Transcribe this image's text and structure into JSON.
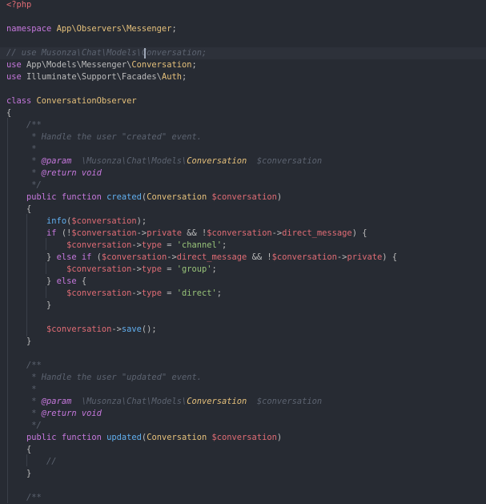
{
  "editor": {
    "language": "php",
    "theme": {
      "background": "#272b33",
      "default": "#bbbbbb",
      "keyword": "#c678dd",
      "class_name": "#e5c07b",
      "function": "#61afef",
      "variable": "#e06c75",
      "string": "#98c379",
      "comment": "#5c6370",
      "doc_tag": "#c678dd",
      "php_tag": "#e06c75"
    },
    "lines": [
      [
        {
          "t": "<?php",
          "c": "php_tag"
        }
      ],
      [],
      [
        {
          "t": "namespace ",
          "c": "keyword"
        },
        {
          "t": "App\\Observers\\Messenger",
          "c": "class_name"
        },
        {
          "t": ";",
          "c": "default"
        }
      ],
      [],
      [
        {
          "t": "// use Musonza\\Chat\\Models\\Conversation;",
          "c": "comment",
          "i": true
        }
      ],
      [
        {
          "t": "use ",
          "c": "keyword"
        },
        {
          "t": "App\\Models\\Messenger\\",
          "c": "default"
        },
        {
          "t": "Conversation",
          "c": "class_name"
        },
        {
          "t": ";",
          "c": "default"
        }
      ],
      [
        {
          "t": "use ",
          "c": "keyword"
        },
        {
          "t": "Illuminate\\Support\\Facades\\",
          "c": "default"
        },
        {
          "t": "Auth",
          "c": "class_name"
        },
        {
          "t": ";",
          "c": "default"
        }
      ],
      [],
      [
        {
          "t": "class ",
          "c": "keyword"
        },
        {
          "t": "ConversationObserver",
          "c": "class_name"
        }
      ],
      [
        {
          "t": "{",
          "c": "default"
        }
      ],
      [
        {
          "t": "    /**",
          "c": "comment",
          "i": true
        }
      ],
      [
        {
          "t": "     * Handle the user \"created\" event.",
          "c": "comment",
          "i": true
        }
      ],
      [
        {
          "t": "     *",
          "c": "comment",
          "i": true
        }
      ],
      [
        {
          "t": "     * ",
          "c": "comment",
          "i": true
        },
        {
          "t": "@param",
          "c": "doc_tag",
          "i": true
        },
        {
          "t": "  \\Musonza\\Chat\\Models\\",
          "c": "comment",
          "i": true
        },
        {
          "t": "Conversation",
          "c": "class_name",
          "i": true
        },
        {
          "t": "  $conversation",
          "c": "comment",
          "i": true
        }
      ],
      [
        {
          "t": "     * ",
          "c": "comment",
          "i": true
        },
        {
          "t": "@return",
          "c": "doc_tag",
          "i": true
        },
        {
          "t": " void",
          "c": "keyword",
          "i": true
        }
      ],
      [
        {
          "t": "     */",
          "c": "comment",
          "i": true
        }
      ],
      [
        {
          "t": "    public function ",
          "c": "keyword"
        },
        {
          "t": "created",
          "c": "function"
        },
        {
          "t": "(",
          "c": "default"
        },
        {
          "t": "Conversation ",
          "c": "class_name"
        },
        {
          "t": "$conversation",
          "c": "variable"
        },
        {
          "t": ")",
          "c": "default"
        }
      ],
      [
        {
          "t": "    {",
          "c": "default"
        }
      ],
      [
        {
          "t": "        ",
          "c": "default"
        },
        {
          "t": "info",
          "c": "function"
        },
        {
          "t": "(",
          "c": "default"
        },
        {
          "t": "$conversation",
          "c": "variable"
        },
        {
          "t": ");",
          "c": "default"
        }
      ],
      [
        {
          "t": "        ",
          "c": "default"
        },
        {
          "t": "if ",
          "c": "keyword"
        },
        {
          "t": "(!",
          "c": "default"
        },
        {
          "t": "$conversation",
          "c": "variable"
        },
        {
          "t": "->",
          "c": "default"
        },
        {
          "t": "private",
          "c": "variable"
        },
        {
          "t": " && !",
          "c": "default"
        },
        {
          "t": "$conversation",
          "c": "variable"
        },
        {
          "t": "->",
          "c": "default"
        },
        {
          "t": "direct_message",
          "c": "variable"
        },
        {
          "t": ") {",
          "c": "default"
        }
      ],
      [
        {
          "t": "            ",
          "c": "default"
        },
        {
          "t": "$conversation",
          "c": "variable"
        },
        {
          "t": "->",
          "c": "default"
        },
        {
          "t": "type",
          "c": "variable"
        },
        {
          "t": " = ",
          "c": "default"
        },
        {
          "t": "'channel'",
          "c": "string"
        },
        {
          "t": ";",
          "c": "default"
        }
      ],
      [
        {
          "t": "        } ",
          "c": "default"
        },
        {
          "t": "else if ",
          "c": "keyword"
        },
        {
          "t": "(",
          "c": "default"
        },
        {
          "t": "$conversation",
          "c": "variable"
        },
        {
          "t": "->",
          "c": "default"
        },
        {
          "t": "direct_message",
          "c": "variable"
        },
        {
          "t": " && !",
          "c": "default"
        },
        {
          "t": "$conversation",
          "c": "variable"
        },
        {
          "t": "->",
          "c": "default"
        },
        {
          "t": "private",
          "c": "variable"
        },
        {
          "t": ") {",
          "c": "default"
        }
      ],
      [
        {
          "t": "            ",
          "c": "default"
        },
        {
          "t": "$conversation",
          "c": "variable"
        },
        {
          "t": "->",
          "c": "default"
        },
        {
          "t": "type",
          "c": "variable"
        },
        {
          "t": " = ",
          "c": "default"
        },
        {
          "t": "'group'",
          "c": "string"
        },
        {
          "t": ";",
          "c": "default"
        }
      ],
      [
        {
          "t": "        } ",
          "c": "default"
        },
        {
          "t": "else ",
          "c": "keyword"
        },
        {
          "t": "{",
          "c": "default"
        }
      ],
      [
        {
          "t": "            ",
          "c": "default"
        },
        {
          "t": "$conversation",
          "c": "variable"
        },
        {
          "t": "->",
          "c": "default"
        },
        {
          "t": "type",
          "c": "variable"
        },
        {
          "t": " = ",
          "c": "default"
        },
        {
          "t": "'direct'",
          "c": "string"
        },
        {
          "t": ";",
          "c": "default"
        }
      ],
      [
        {
          "t": "        }",
          "c": "default"
        }
      ],
      [],
      [
        {
          "t": "        ",
          "c": "default"
        },
        {
          "t": "$conversation",
          "c": "variable"
        },
        {
          "t": "->",
          "c": "default"
        },
        {
          "t": "save",
          "c": "function"
        },
        {
          "t": "();",
          "c": "default"
        }
      ],
      [
        {
          "t": "    }",
          "c": "default"
        }
      ],
      [],
      [
        {
          "t": "    /**",
          "c": "comment",
          "i": true
        }
      ],
      [
        {
          "t": "     * Handle the user \"updated\" event.",
          "c": "comment",
          "i": true
        }
      ],
      [
        {
          "t": "     *",
          "c": "comment",
          "i": true
        }
      ],
      [
        {
          "t": "     * ",
          "c": "comment",
          "i": true
        },
        {
          "t": "@param",
          "c": "doc_tag",
          "i": true
        },
        {
          "t": "  \\Musonza\\Chat\\Models\\",
          "c": "comment",
          "i": true
        },
        {
          "t": "Conversation",
          "c": "class_name",
          "i": true
        },
        {
          "t": "  $conversation",
          "c": "comment",
          "i": true
        }
      ],
      [
        {
          "t": "     * ",
          "c": "comment",
          "i": true
        },
        {
          "t": "@return",
          "c": "doc_tag",
          "i": true
        },
        {
          "t": " void",
          "c": "keyword",
          "i": true
        }
      ],
      [
        {
          "t": "     */",
          "c": "comment",
          "i": true
        }
      ],
      [
        {
          "t": "    public function ",
          "c": "keyword"
        },
        {
          "t": "updated",
          "c": "function"
        },
        {
          "t": "(",
          "c": "default"
        },
        {
          "t": "Conversation ",
          "c": "class_name"
        },
        {
          "t": "$conversation",
          "c": "variable"
        },
        {
          "t": ")",
          "c": "default"
        }
      ],
      [
        {
          "t": "    {",
          "c": "default"
        }
      ],
      [
        {
          "t": "        ",
          "c": "default"
        },
        {
          "t": "//",
          "c": "comment",
          "i": true
        }
      ],
      [
        {
          "t": "    }",
          "c": "default"
        }
      ],
      [],
      [
        {
          "t": "    /**",
          "c": "comment",
          "i": true
        }
      ]
    ]
  }
}
